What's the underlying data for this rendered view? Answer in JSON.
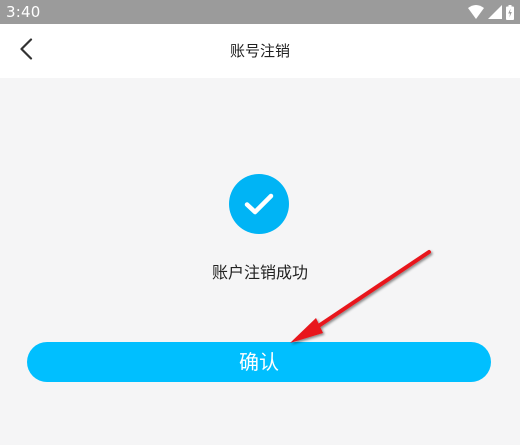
{
  "status_bar": {
    "time": "3:40",
    "icons": [
      "wifi-icon",
      "cellular-signal-icon",
      "battery-icon"
    ]
  },
  "header": {
    "title": "账号注销",
    "back_icon": "chevron-left-icon"
  },
  "content": {
    "success_icon": "checkmark-circle-icon",
    "message": "账户注销成功",
    "confirm_label": "确认"
  },
  "colors": {
    "accent": "#00bfff",
    "status_bar": "#9b9b9b",
    "background": "#f5f5f6",
    "annotation": "#e8141b"
  }
}
